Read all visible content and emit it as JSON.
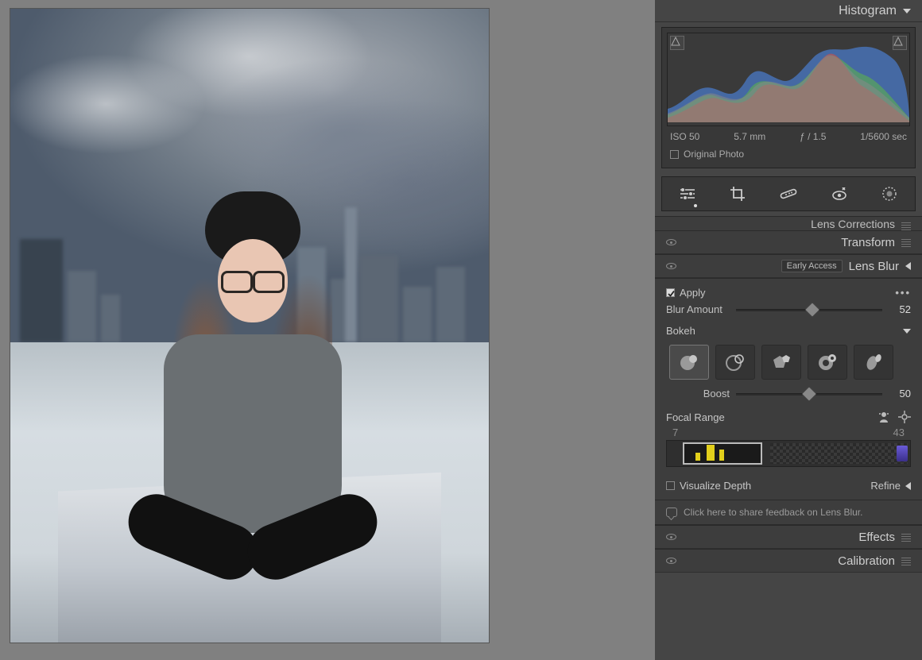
{
  "histogram": {
    "title": "Histogram",
    "iso": "ISO 50",
    "focal_length": "5.7 mm",
    "aperture": "ƒ / 1.5",
    "shutter": "1/5600 sec",
    "original_photo_label": "Original Photo",
    "original_photo_checked": false
  },
  "tool_icons": [
    "edit-sliders",
    "crop",
    "heal",
    "redeye",
    "radial-mask"
  ],
  "collapsed_sections": {
    "lens_corrections": "Lens Corrections",
    "transform": "Transform",
    "effects": "Effects",
    "calibration": "Calibration"
  },
  "lens_blur": {
    "title": "Lens Blur",
    "badge": "Early Access",
    "apply_label": "Apply",
    "apply_checked": true,
    "blur_amount_label": "Blur Amount",
    "blur_amount_value": 52,
    "bokeh_label": "Bokeh",
    "bokeh_selected_index": 0,
    "bokeh_options": [
      "circle",
      "soap-bubble",
      "blade-5",
      "ring",
      "cats-eye"
    ],
    "boost_label": "Boost",
    "boost_value": 50,
    "focal_range_label": "Focal Range",
    "focal_range_min": 7,
    "focal_range_max": 43,
    "visualize_depth_label": "Visualize Depth",
    "visualize_depth_checked": false,
    "refine_label": "Refine",
    "feedback_text": "Click here to share feedback on Lens Blur."
  }
}
